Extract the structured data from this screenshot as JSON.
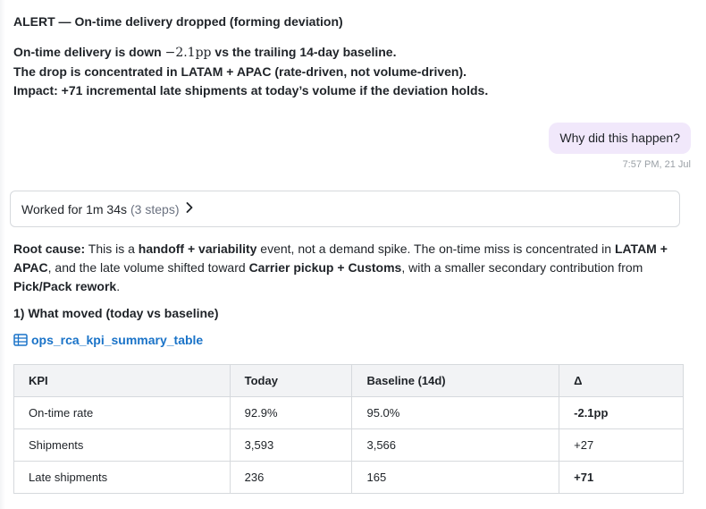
{
  "alert": {
    "title": "ALERT — On-time delivery dropped (forming deviation)",
    "line1_prefix": "On-time delivery is down ",
    "line1_math": "−2.1pp",
    "line1_suffix": " vs the trailing 14-day baseline.",
    "line2": "The drop is concentrated in LATAM + APAC (rate-driven, not volume-driven).",
    "line3": "Impact: +71 incremental late shipments at today’s volume if the deviation holds."
  },
  "user_message": {
    "text": "Why did this happen?",
    "timestamp": "7:57 PM, 21 Jul"
  },
  "worked": {
    "label": "Worked for 1m 34s",
    "steps": "(3 steps)",
    "chevron_icon": "chevron-right-icon"
  },
  "root_cause": {
    "label": "Root cause:",
    "t1": " This is a ",
    "b1": "handoff + variability",
    "t2": " event, not a demand spike. The on-time miss is concentrated in ",
    "b2": "LATAM + APAC",
    "t3": ", and the late volume shifted toward ",
    "b3": "Carrier pickup + Customs",
    "t4": ", with a smaller secondary contribution from ",
    "b4": "Pick/Pack rework",
    "t5": "."
  },
  "section": {
    "heading": "1) What moved (today vs baseline)"
  },
  "table_link": {
    "label": "ops_rca_kpi_summary_table",
    "icon": "table-icon",
    "color": "#1a73c8"
  },
  "kpi_table": {
    "headers": [
      "KPI",
      "Today",
      "Baseline (14d)",
      "Δ"
    ],
    "rows": [
      [
        "On-time rate",
        "92.9%",
        "95.0%",
        "-2.1pp"
      ],
      [
        "Shipments",
        "3,593",
        "3,566",
        "+27"
      ],
      [
        "Late shipments",
        "236",
        "165",
        "+71"
      ]
    ]
  },
  "colors": {
    "user_bubble": "#f1e8fb",
    "link": "#1a73c8",
    "table_header": "#f2f3f5"
  }
}
